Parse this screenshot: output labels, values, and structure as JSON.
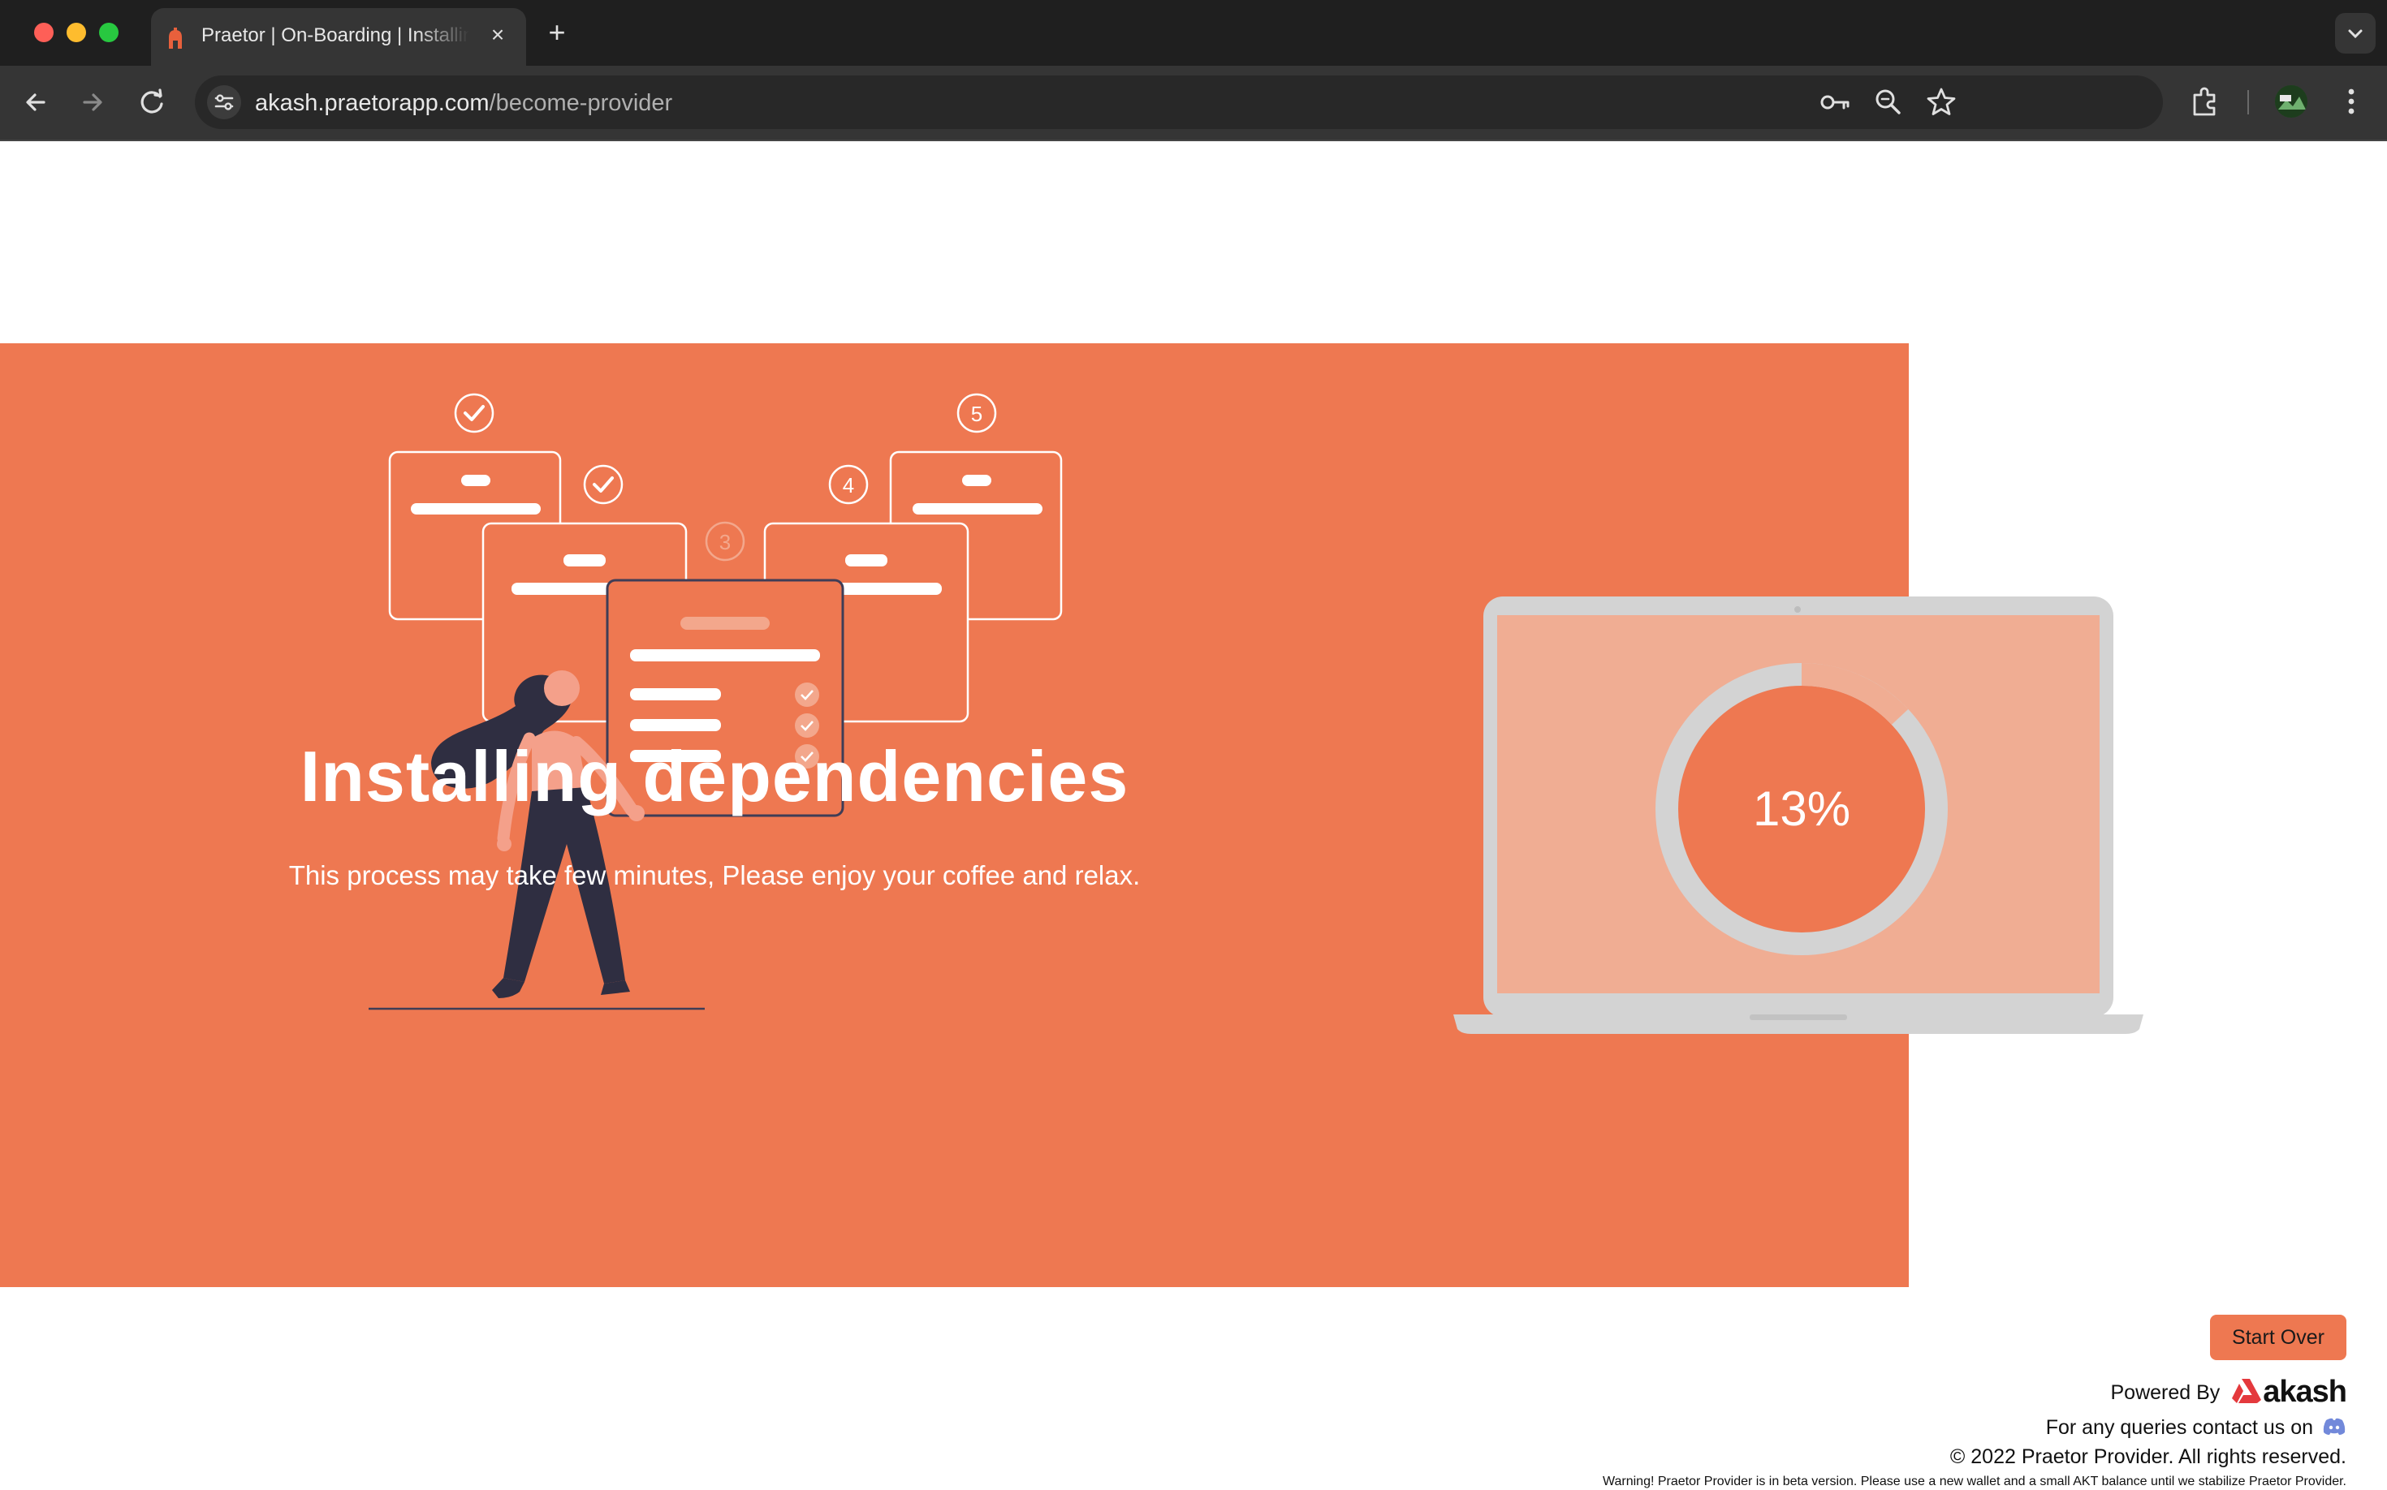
{
  "browser": {
    "tab_title": "Praetor | On-Boarding | Installing Dependencies",
    "tab_close": "×",
    "new_tab": "+",
    "url_host": "akash.praetorapp.com",
    "url_path": "/become-provider"
  },
  "illustration": {
    "step_labels": [
      "✓",
      "✓",
      "3",
      "4",
      "5"
    ]
  },
  "progress": {
    "percent_label": "13%",
    "value": 13
  },
  "hero": {
    "title": "Installing dependencies",
    "subtitle": "This process may take few minutes, Please enjoy your coffee and relax."
  },
  "actions": {
    "start_over": "Start Over"
  },
  "footer": {
    "powered_by": "Powered By",
    "brand": "akash",
    "contact": "For any queries contact us on",
    "copyright": "© 2022 Praetor Provider. All rights reserved.",
    "warning": "Warning! Praetor Provider is in beta version. Please use a new wallet and a small AKT balance until we stabilize Praetor Provider."
  },
  "colors": {
    "accent": "#ee7851",
    "screen": "#f0ad93",
    "laptop": "#d3d3d3",
    "figure_dark": "#2f2e41"
  }
}
